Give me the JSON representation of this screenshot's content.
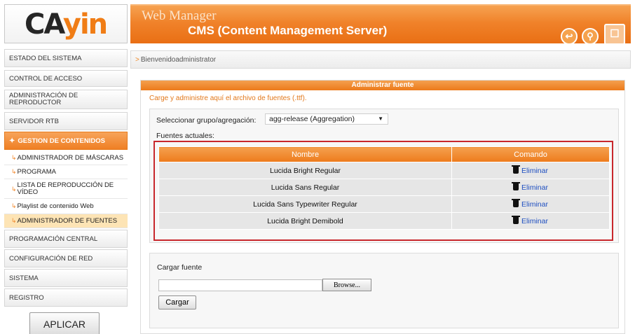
{
  "logo": {
    "part1": "CA",
    "part2": "yin"
  },
  "header": {
    "title": "Web Manager",
    "subtitle": "CMS (Content Management Server)",
    "icons": [
      "logout-icon",
      "key-icon",
      "monitor-icon"
    ]
  },
  "sidebar": {
    "items": [
      {
        "label": "ESTADO DEL SISTEMA"
      },
      {
        "label": "CONTROL DE ACCESO"
      },
      {
        "label": "ADMINISTRACIÓN DE REPRODUCTOR"
      },
      {
        "label": "SERVIDOR RTB"
      },
      {
        "label": "GESTION DE CONTENIDOS"
      },
      {
        "label": "PROGRAMACIÓN CENTRAL"
      },
      {
        "label": "CONFIGURACIÓN DE RED"
      },
      {
        "label": "SISTEMA"
      },
      {
        "label": "REGISTRO"
      }
    ],
    "subitems": [
      {
        "label": "ADMINISTRADOR DE MÁSCARAS"
      },
      {
        "label": "PROGRAMA"
      },
      {
        "label": "LISTA DE REPRODUCCIÓN DE VÍDEO"
      },
      {
        "label": "Playlist de contenido Web"
      },
      {
        "label": "ADMINISTRADOR DE FUENTES"
      }
    ],
    "apply_label": "APLICAR"
  },
  "breadcrumb": {
    "text": "Bienvenidoadministrator"
  },
  "panel": {
    "title": "Administrar fuente",
    "description": "Carge y administre aquí el archivo de fuentes (.ttf).",
    "group_label": "Seleccionar grupo/agregación:",
    "group_value": "agg-release (Aggregation)",
    "fonts_label": "Fuentes actuales:",
    "table": {
      "headers": [
        "Nombre",
        "Comando"
      ],
      "rows": [
        {
          "name": "Lucida Bright Regular",
          "action": "Eliminar"
        },
        {
          "name": "Lucida Sans Regular",
          "action": "Eliminar"
        },
        {
          "name": "Lucida Sans Typewriter Regular",
          "action": "Eliminar"
        },
        {
          "name": "Lucida Bright Demibold",
          "action": "Eliminar"
        }
      ]
    },
    "upload": {
      "label": "Cargar fuente",
      "browse_label": "Browse...",
      "submit_label": "Cargar"
    }
  },
  "colors": {
    "accent": "#f0822a",
    "highlight_frame": "#c8272c",
    "link": "#1f4fc0"
  }
}
